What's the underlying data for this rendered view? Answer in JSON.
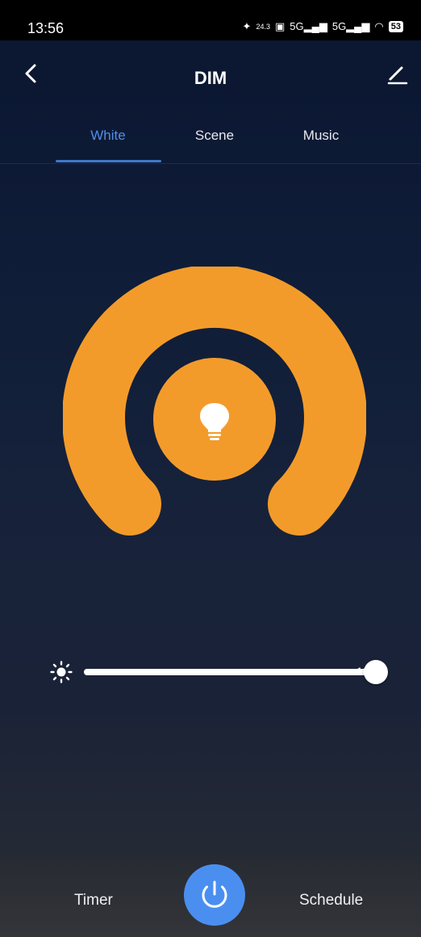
{
  "status_bar": {
    "time": "13:56",
    "battery": "53",
    "icons": [
      "notification-icon",
      "data-speed-icon",
      "hd-icon",
      "5g-signal-icon",
      "5g-signal-icon",
      "wifi-icon",
      "battery-icon"
    ],
    "data_speed": "24.3"
  },
  "header": {
    "title": "DIM"
  },
  "tabs": [
    {
      "label": "White",
      "active": true
    },
    {
      "label": "Scene",
      "active": false
    },
    {
      "label": "Music",
      "active": false
    }
  ],
  "brightness": {
    "value": 100,
    "label": "100%"
  },
  "colors": {
    "accent": "#f39b2a",
    "tab_active": "#4f8fe6",
    "power": "#4a8ff0"
  },
  "bottom": {
    "timer_label": "Timer",
    "schedule_label": "Schedule"
  }
}
